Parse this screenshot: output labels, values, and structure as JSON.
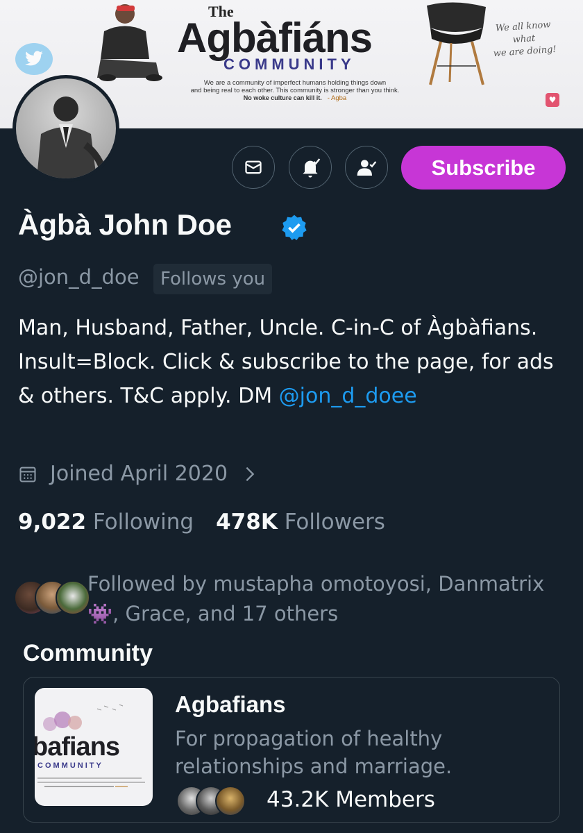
{
  "banner": {
    "the": "The",
    "brand": "Agbàfiáns",
    "community": "COMMUNITY",
    "tagline_line1": "We are a community of imperfect humans holding things down",
    "tagline_line2": "and being real to each other. This community is stronger than you think.",
    "tagline_line3": "No woke culture can kill it.",
    "tagline_sig": "- Agba",
    "script_line1": "We all know what",
    "script_line2": "we are doing!"
  },
  "actions": {
    "message_icon": "envelope-icon",
    "notify_icon": "bell-check-icon",
    "follow_icon": "person-check-icon",
    "subscribe_label": "Subscribe",
    "subscribe_color": "#c736d6"
  },
  "profile": {
    "name": "Àgbà John Doe",
    "handle": "@jon_d_doe",
    "follows_you": "Follows you",
    "bio_text": "Man, Husband, Father, Uncle. C-in-C of Àgbàfians.  Insult=Block. Click & subscribe to the page, for ads & others. T&C apply.  DM ",
    "bio_mention": "@jon_d_doee",
    "joined": "Joined April 2020",
    "following_count": "9,022",
    "following_label": "Following",
    "followers_count": "478K",
    "followers_label": "Followers",
    "followed_by_line1": "Followed by mustapha omotoyosi, Danmatrix",
    "followed_by_line2": "👾, Grace, and 17 others"
  },
  "community": {
    "heading": "Community",
    "name": "Agbafians",
    "description": "For propagation of healthy relationships and marriage.",
    "members": "43.2K Members",
    "thumb_brand": "bafians",
    "thumb_community": "COMMUNITY"
  },
  "colors": {
    "background": "#15202b",
    "accent_link": "#1d9bf0",
    "verified": "#1d9bf0",
    "muted": "#8b98a5"
  }
}
